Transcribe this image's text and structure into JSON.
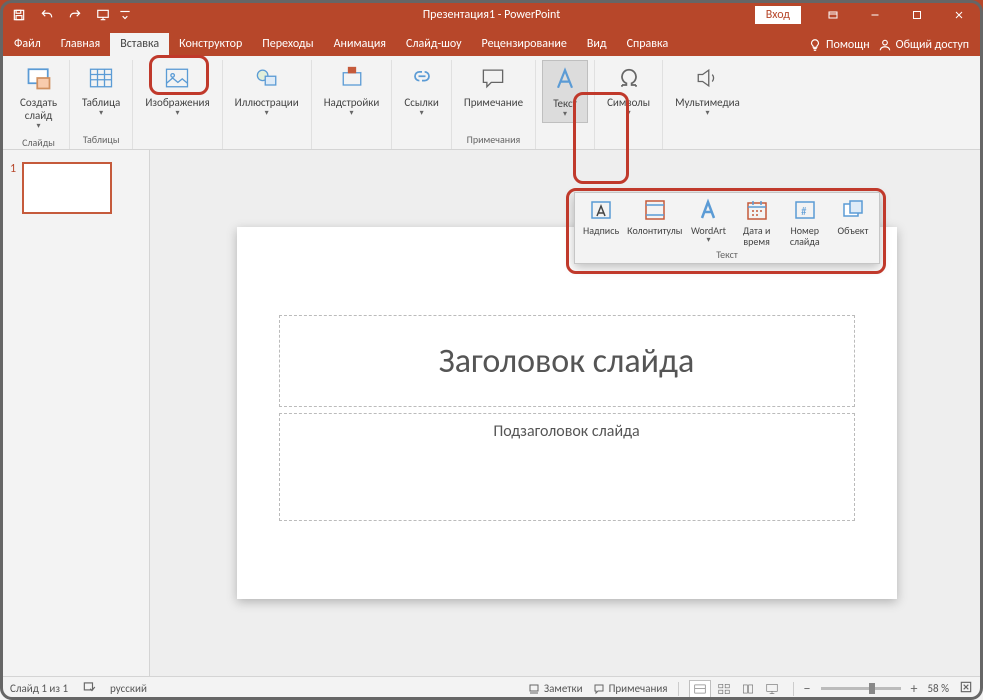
{
  "title": "Презентация1 - PowerPoint",
  "login": "Вход",
  "tabs": {
    "file": "Файл",
    "home": "Главная",
    "insert": "Вставка",
    "design": "Конструктор",
    "transitions": "Переходы",
    "animations": "Анимация",
    "slideshow": "Слайд-шоу",
    "review": "Рецензирование",
    "view": "Вид",
    "help": "Справка"
  },
  "tabs_right": {
    "tell_me": "Помощн",
    "share": "Общий доступ"
  },
  "ribbon": {
    "new_slide": "Создать\nслайд",
    "slides_group": "Слайды",
    "table": "Таблица",
    "tables_group": "Таблицы",
    "images": "Изображения",
    "illustrations": "Иллюстрации",
    "addins": "Надстройки",
    "links": "Ссылки",
    "comment": "Примечание",
    "comments_group": "Примечания",
    "text": "Текст",
    "symbols": "Символы",
    "media": "Мультимедиа"
  },
  "popup": {
    "textbox": "Надпись",
    "header_footer": "Колонтитулы",
    "wordart": "WordArt",
    "date_time": "Дата и\nвремя",
    "slide_number": "Номер\nслайда",
    "object": "Объект",
    "group": "Текст"
  },
  "slide": {
    "number": "1",
    "title_ph": "Заголовок слайда",
    "subtitle_ph": "Подзаголовок слайда"
  },
  "status": {
    "slide_info": "Слайд 1 из 1",
    "language": "русский",
    "notes": "Заметки",
    "comments": "Примечания",
    "zoom": "58 %"
  }
}
